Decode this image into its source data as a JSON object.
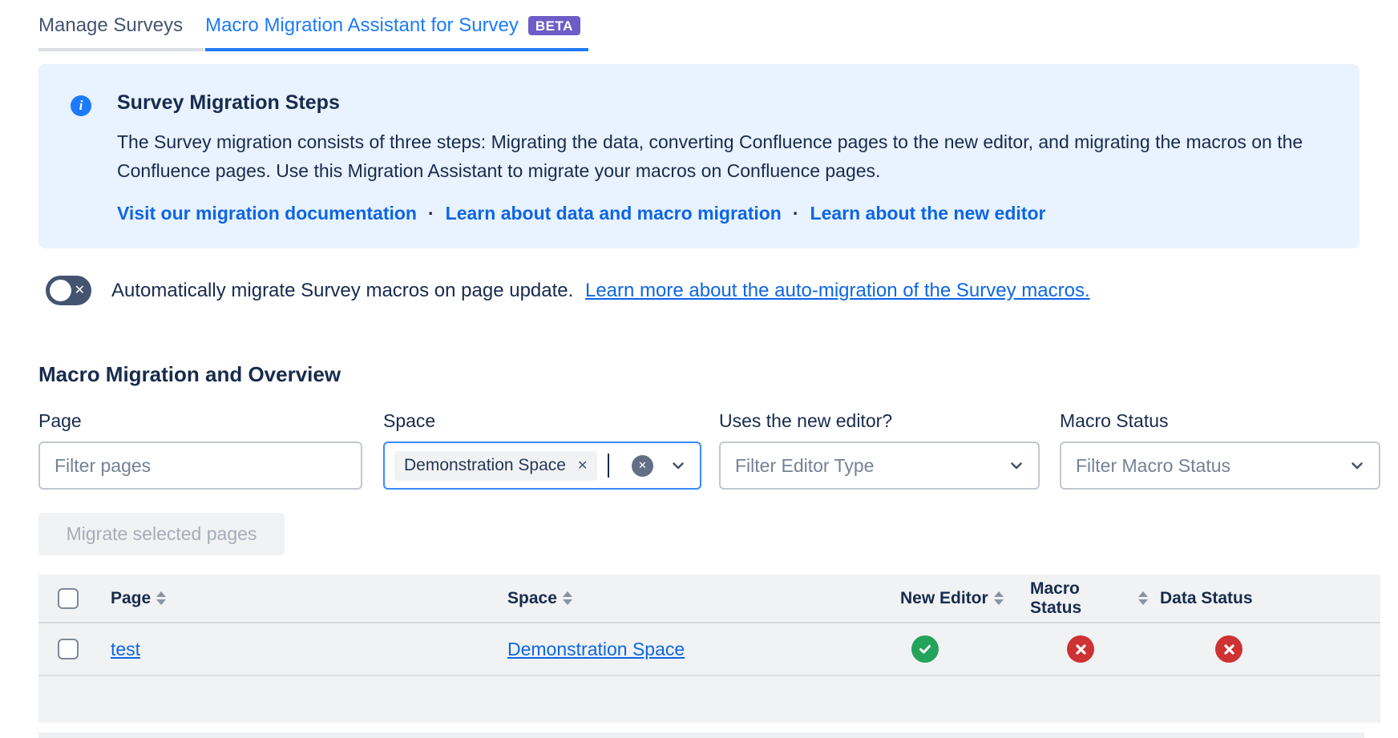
{
  "tabs": {
    "items": [
      {
        "label": "Manage Surveys",
        "active": false
      },
      {
        "label": "Macro Migration Assistant for Survey",
        "badge": "BETA",
        "active": true
      }
    ]
  },
  "info_panel": {
    "icon": "info-icon",
    "title": "Survey Migration Steps",
    "body": "The Survey migration consists of three steps: Migrating the data, converting Confluence pages to the new editor, and migrating the macros on the Confluence pages. Use this Migration Assistant to migrate your macros on Confluence pages.",
    "links": [
      "Visit our migration documentation",
      "Learn about data and macro migration",
      "Learn about the new editor"
    ],
    "separator": "·"
  },
  "auto_migration": {
    "toggle_state": "off",
    "text": "Automatically migrate Survey macros on page update.",
    "link": "Learn more about the auto-migration of the Survey macros."
  },
  "section_title": "Macro Migration and Overview",
  "filters": {
    "page": {
      "label": "Page",
      "placeholder": "Filter pages",
      "value": ""
    },
    "space": {
      "label": "Space",
      "selected": [
        "Demonstration Space"
      ],
      "focused": true
    },
    "editor": {
      "label": "Uses the new editor?",
      "placeholder": "Filter Editor Type"
    },
    "macro_status": {
      "label": "Macro Status",
      "placeholder": "Filter Macro Status"
    }
  },
  "actions": {
    "migrate_button": {
      "label": "Migrate selected pages",
      "enabled": false
    }
  },
  "table": {
    "headers": [
      {
        "label": "Page",
        "sortable": true
      },
      {
        "label": "Space",
        "sortable": true
      },
      {
        "label": "New Editor",
        "sortable": true
      },
      {
        "label": "Macro Status",
        "sortable": true
      },
      {
        "label": "Data Status",
        "sortable": false
      }
    ],
    "rows": [
      {
        "page": "test",
        "space": "Demonstration Space",
        "new_editor": "success",
        "macro_status": "error",
        "data_status": "error",
        "selected": false
      }
    ]
  },
  "colors": {
    "accent_blue": "#1D7AFC",
    "link_blue": "#0C66E4",
    "info_bg": "#E9F2FF",
    "badge_purple": "#6E5DC6",
    "toggle_off": "#44546F",
    "success_green": "#24A35B",
    "error_red": "#CE3232",
    "table_bg": "#F1F2F4",
    "text_dark": "#172B4D"
  }
}
